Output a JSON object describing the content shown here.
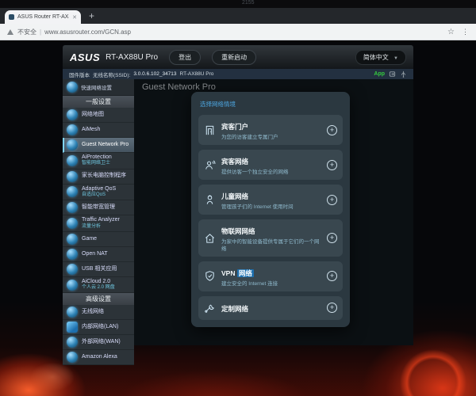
{
  "desktop": {
    "artifact": "2155"
  },
  "browser": {
    "tab": {
      "title": "ASUS Router RT-AX88U Pro",
      "close": "✕",
      "new_tab": "+"
    },
    "toolbar": {
      "security_label": "不安全",
      "separator": "|",
      "url": "www.asusrouter.com/GCN.asp",
      "star": "☆",
      "menu": "⋮"
    }
  },
  "app": {
    "header": {
      "brand": "ASUS",
      "model": "RT-AX88U Pro",
      "logout_label": "登出",
      "reboot_label": "重新启动",
      "language": "简体中文",
      "caret": "▼"
    },
    "infobar": {
      "firmware_label": "固件版本",
      "ssid_label": "无线名称(SSID):",
      "firmware_value": "3.0.0.6.102_34713",
      "model": "RT-AX88U Pro",
      "app_badge": "App"
    },
    "sidebar": {
      "quick_setup": "快速网络设置",
      "sections": [
        {
          "title": "一般设置",
          "items": [
            {
              "label": "网络地图"
            },
            {
              "label": "AiMesh"
            },
            {
              "label": "Guest Network Pro"
            },
            {
              "label": "AiProtection",
              "sub": "智能网络卫士"
            },
            {
              "label": "家长电脑控制程序"
            },
            {
              "label": "Adaptive QoS",
              "sub": "自适应QoS"
            },
            {
              "label": "智能带宽管理"
            },
            {
              "label": "Traffic Analyzer",
              "sub": "流量分析"
            },
            {
              "label": "Game"
            },
            {
              "label": "Open NAT"
            },
            {
              "label": "USB 相关应用"
            },
            {
              "label": "AiCloud 2.0",
              "sub": "个人云 2.0 网盘"
            }
          ]
        },
        {
          "title": "高级设置",
          "items": [
            {
              "label": "无线网络"
            },
            {
              "label": "内部网络(LAN)"
            },
            {
              "label": "外部网络(WAN)"
            },
            {
              "label": "Amazon Alexa"
            }
          ]
        }
      ]
    },
    "main": {
      "page_title": "Guest Network Pro",
      "modal": {
        "title": "选择网络情境",
        "add_glyph": "+",
        "cards": [
          {
            "title": "宾客门户",
            "desc": "为您的访客建立专属门户"
          },
          {
            "title": "宾客网络",
            "desc": "提供访客一个独立安全的网络"
          },
          {
            "title": "儿童网络",
            "desc": "管理孩子们的 Internet 使用时间"
          },
          {
            "title": "物联网网络",
            "desc": "为家中的智能设备提供专属于它们的一个网络"
          },
          {
            "title": "VPN",
            "title_hl": "网络",
            "desc": "建立安全的 Internet 连接"
          },
          {
            "title": "定制网络",
            "desc": ""
          }
        ]
      }
    },
    "colors": {
      "accent_blue": "#4da6e0",
      "selected_glow": "#7fd4ff",
      "app_green": "#35c93f",
      "artwork_red": "#ff401a"
    }
  }
}
